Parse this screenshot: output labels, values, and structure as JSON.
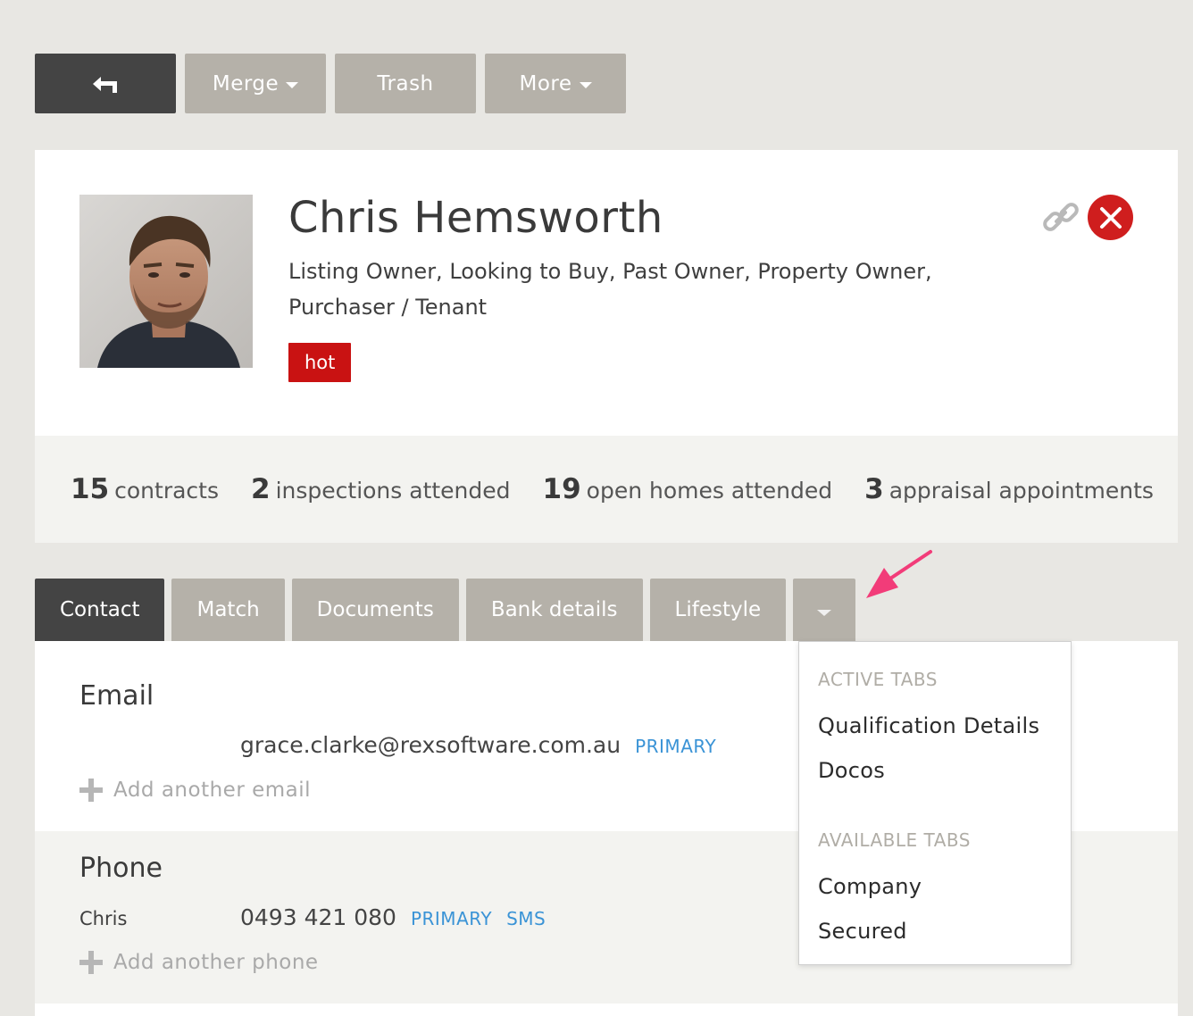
{
  "toolbar": {
    "back_icon": "back-arrow-icon",
    "merge_label": "Merge",
    "trash_label": "Trash",
    "more_label": "More"
  },
  "profile": {
    "name": "Chris Hemsworth",
    "roles": "Listing Owner, Looking to Buy, Past Owner, Property Owner, Purchaser / Tenant",
    "tag": "hot",
    "tag_color": "#c91212",
    "link_icon": "link-icon",
    "close_icon": "close-icon"
  },
  "stats": [
    {
      "num": "15",
      "label": "contracts"
    },
    {
      "num": "2",
      "label": "inspections attended"
    },
    {
      "num": "19",
      "label": "open homes attended"
    },
    {
      "num": "3",
      "label": "appraisal appointments"
    }
  ],
  "tabs": {
    "items": [
      "Contact",
      "Match",
      "Documents",
      "Bank details",
      "Lifestyle"
    ],
    "active": "Contact"
  },
  "email": {
    "title": "Email",
    "value": "grace.clarke@rexsoftware.com.au",
    "badge": "PRIMARY",
    "add_label": "Add another email"
  },
  "phone": {
    "title": "Phone",
    "label": "Chris",
    "value": "0493 421 080",
    "badge_primary": "PRIMARY",
    "badge_sms": "SMS",
    "add_label": "Add another phone"
  },
  "dropdown": {
    "active_heading": "ACTIVE TABS",
    "active_items": [
      "Qualification Details",
      "Docos"
    ],
    "available_heading": "AVAILABLE TABS",
    "available_items": [
      "Company",
      "Secured"
    ]
  },
  "colors": {
    "accent_blue": "#3a93d6",
    "annotation_arrow": "#f23c79"
  }
}
